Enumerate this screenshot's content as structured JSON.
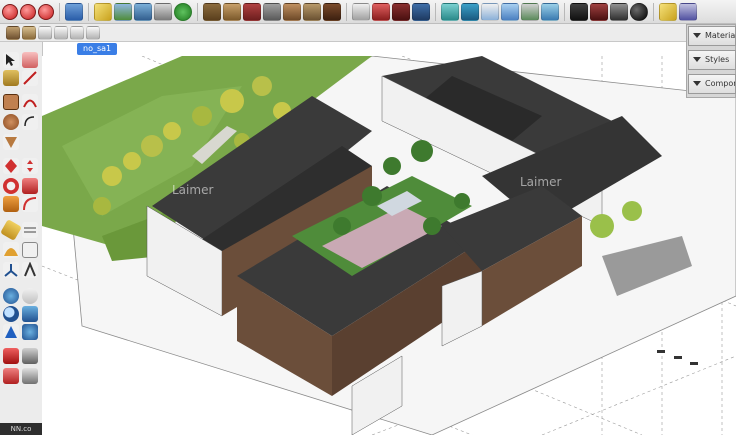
{
  "scene": {
    "tab_label": "no_sa1"
  },
  "tray": {
    "tabs": [
      {
        "label": "Materials"
      },
      {
        "label": "Styles"
      },
      {
        "label": "Components"
      }
    ]
  },
  "watermark": {
    "text": "Laimer"
  },
  "status": {
    "text": "NN.co"
  },
  "colors": {
    "accent_blue": "#3a7ee6",
    "grass": "#7aa84a",
    "roof_dark": "#3a3a3a",
    "wall_brown": "#6b4e3a",
    "wall_white": "#f1f1f1",
    "courtyard_green": "#4f8c3a",
    "paving_pink": "#c9a9b4"
  },
  "icons": {
    "top_toolbar": [
      "close-window-icon",
      "minimize-window-icon",
      "zoom-window-icon",
      "open-file-icon",
      "pencil-icon",
      "landscape-icon",
      "layers-icon",
      "paint-bucket-icon",
      "help-icon",
      "walls-icon",
      "crate-icon",
      "warehouse-icon",
      "roof-icon",
      "stairs-icon",
      "fence-icon",
      "text-3d-icon",
      "terrain-icon",
      "building-icon",
      "anchor-icon",
      "photo-icon",
      "ruler-icon",
      "truck-icon",
      "measure-icon",
      "sun-icon",
      "shadows-icon",
      "ball-icon",
      "wrench-icon",
      "eraser-icon",
      "sphere-icon"
    ],
    "left_toolbar": [
      "select-arrow-icon",
      "eraser-icon",
      "paint-bucket-icon",
      "line-icon",
      "rectangle-icon",
      "arc-icon",
      "circle-icon",
      "polygon-icon",
      "push-pull-icon",
      "move-icon",
      "rotate-icon",
      "scale-icon",
      "follow-me-icon",
      "offset-icon",
      "tape-measure-icon",
      "dimension-icon",
      "protractor-icon",
      "text-icon",
      "axes-icon",
      "3d-text-icon",
      "orbit-icon",
      "pan-icon",
      "zoom-icon",
      "zoom-extents-icon",
      "walk-icon",
      "look-around-icon",
      "position-camera-icon",
      "section-plane-icon"
    ]
  }
}
